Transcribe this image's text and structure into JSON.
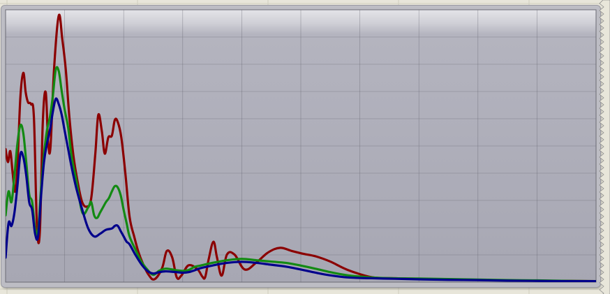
{
  "chart_data": {
    "type": "line",
    "title": "",
    "xlabel": "",
    "ylabel": "",
    "xlim": [
      0,
      100
    ],
    "ylim": [
      0,
      100
    ],
    "grid": true,
    "legend": "none",
    "series": [
      {
        "color": "#8b0000",
        "x": [
          0,
          0.4,
          0.8,
          1.2,
          1.6,
          2.0,
          2.5,
          3.0,
          3.4,
          3.8,
          4.3,
          4.8,
          5.3,
          5.8,
          6.3,
          6.8,
          7.2,
          7.6,
          8.2,
          9.0,
          9.6,
          10.2,
          10.8,
          11.5,
          12.3,
          13.0,
          13.8,
          14.5,
          15.2,
          15.7,
          16.3,
          16.8,
          17.4,
          18.0,
          18.5,
          19.0,
          19.6,
          20.3,
          21.0,
          21.8,
          22.5,
          23.3,
          24.2,
          25.2,
          26.5,
          27.3,
          28.2,
          29.0,
          29.8,
          31.0,
          32.5,
          33.3,
          33.8,
          34.4,
          35.2,
          35.8,
          36.6,
          37.5,
          38.8,
          40.5,
          42.5,
          44.5,
          46.5,
          48.5,
          50.5,
          52.5,
          55.0,
          58.0,
          62.0,
          66.0,
          70.0,
          75.0,
          80.0,
          85.0,
          90.0,
          95.0,
          100.0
        ],
        "y": [
          50.0,
          45.1,
          49.2,
          40.9,
          33.9,
          43.4,
          69.4,
          78.8,
          71.5,
          67.7,
          67.0,
          61.8,
          21.7,
          18.6,
          60.0,
          71.5,
          53.0,
          50.7,
          79.9,
          100.4,
          91.6,
          79.9,
          62.2,
          47.3,
          36.5,
          29.8,
          28.3,
          31.4,
          48.3,
          62.9,
          56.8,
          48.3,
          54.4,
          55.1,
          61.0,
          60.2,
          54.4,
          40.5,
          24.4,
          16.8,
          11.1,
          6.5,
          2.6,
          0.8,
          5.0,
          11.5,
          9.2,
          1.5,
          2.3,
          6.1,
          4.6,
          1.9,
          1.6,
          8.4,
          15.0,
          9.1,
          2.2,
          10.2,
          10.1,
          4.5,
          7.2,
          11.0,
          12.7,
          11.5,
          10.4,
          9.5,
          7.5,
          4.3,
          1.6,
          1.2,
          1.0,
          0.8,
          0.6,
          0.4,
          0.3,
          0.2,
          0.1
        ]
      },
      {
        "color": "#138a13",
        "x": [
          0,
          0.5,
          1.0,
          1.5,
          2.0,
          2.5,
          3.0,
          3.5,
          4.0,
          4.5,
          5.0,
          5.5,
          6.0,
          6.5,
          7.0,
          7.5,
          8.0,
          8.5,
          9.0,
          9.5,
          10.0,
          10.6,
          11.2,
          12.0,
          13.0,
          14.0,
          14.5,
          15.0,
          15.5,
          16.0,
          16.5,
          17.0,
          17.5,
          18.0,
          18.5,
          19.0,
          19.5,
          20.0,
          20.5,
          21.0,
          22.0,
          23.0,
          24.0,
          25.0,
          26.0,
          27.0,
          28.0,
          29.0,
          30.0,
          31.0,
          32.0,
          33.0,
          35.0,
          37.5,
          40.0,
          42.5,
          45.0,
          47.5,
          50.0,
          52.5,
          55.0,
          58.0,
          62.0,
          66.0,
          70.0,
          75.0,
          80.0,
          85.0,
          90.0,
          95.0,
          100.0
        ],
        "y": [
          25.0,
          34.0,
          30.0,
          40.0,
          52.0,
          59.0,
          56.0,
          45.0,
          33.0,
          30.0,
          20.0,
          19.0,
          35.0,
          48.0,
          57.0,
          62.0,
          70.0,
          80.0,
          79.5,
          72.0,
          65.0,
          58.0,
          47.0,
          38.0,
          26.0,
          28.0,
          30.0,
          25.0,
          24.0,
          26.0,
          28.0,
          30.0,
          31.5,
          34.0,
          36.0,
          35.5,
          32.5,
          27.0,
          22.0,
          17.0,
          12.0,
          7.5,
          4.5,
          2.5,
          4.0,
          4.8,
          4.6,
          4.2,
          4.0,
          4.3,
          5.5,
          6.0,
          7.0,
          8.0,
          8.5,
          8.0,
          7.5,
          7.0,
          6.0,
          4.8,
          3.5,
          2.3,
          1.5,
          1.2,
          1.1,
          0.9,
          0.7,
          0.5,
          0.4,
          0.2,
          0.1
        ]
      },
      {
        "color": "#00008b",
        "x": [
          0,
          0.5,
          1.0,
          1.5,
          2.0,
          2.5,
          3.0,
          3.5,
          4.0,
          4.5,
          5.0,
          5.5,
          6.0,
          6.5,
          7.0,
          7.5,
          8.0,
          8.5,
          9.0,
          9.5,
          10.0,
          10.6,
          11.2,
          12.0,
          13.0,
          14.0,
          15.0,
          16.0,
          17.0,
          18.0,
          18.5,
          19.0,
          19.5,
          20.0,
          20.5,
          21.0,
          22.0,
          23.0,
          24.0,
          25.0,
          26.0,
          27.0,
          28.0,
          29.0,
          30.0,
          31.0,
          32.0,
          33.0,
          35.0,
          37.5,
          40.0,
          42.5,
          45.0,
          47.5,
          50.0,
          52.5,
          55.0,
          58.0,
          62.0,
          66.0,
          70.0,
          75.0,
          80.0,
          85.0,
          90.0,
          95.0,
          100.0
        ],
        "y": [
          9.0,
          22.0,
          21.0,
          26.0,
          36.0,
          48.0,
          47.0,
          40.0,
          30.0,
          27.0,
          18.0,
          17.0,
          32.0,
          45.0,
          52.0,
          57.0,
          64.0,
          69.0,
          67.0,
          63.0,
          57.0,
          50.0,
          43.0,
          35.0,
          27.0,
          20.0,
          17.0,
          18.0,
          19.5,
          20.0,
          21.0,
          21.0,
          19.0,
          17.0,
          15.0,
          14.0,
          10.0,
          6.5,
          4.0,
          3.0,
          3.5,
          3.8,
          3.7,
          3.5,
          3.3,
          3.5,
          4.2,
          5.0,
          6.0,
          7.0,
          7.4,
          7.0,
          6.3,
          5.6,
          4.5,
          3.3,
          2.3,
          1.5,
          1.2,
          1.0,
          0.8,
          0.6,
          0.5,
          0.3,
          0.2,
          0.1,
          0.1
        ]
      }
    ]
  }
}
